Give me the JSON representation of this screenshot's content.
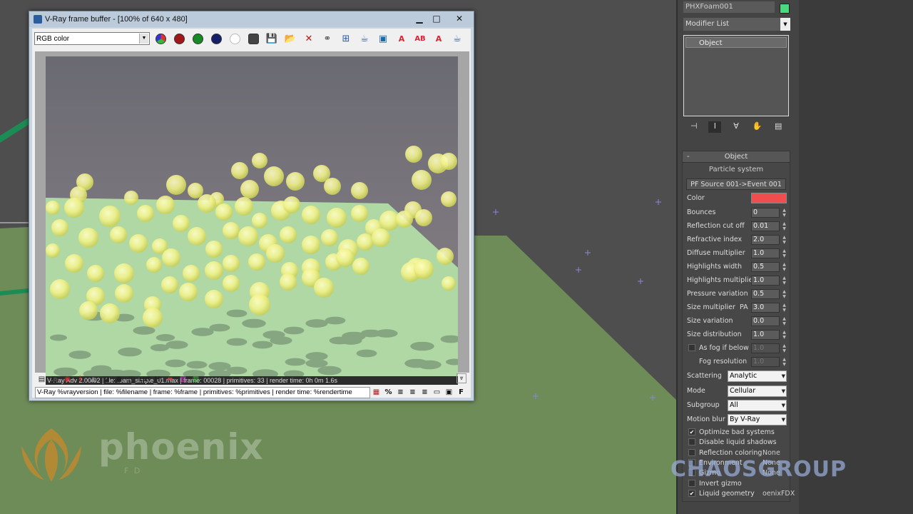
{
  "vfb": {
    "title": "V-Ray frame buffer - [100% of 640 x 480]",
    "minimize": "▁",
    "maximize": "□",
    "close": "✕",
    "channel": "RGB color",
    "status_line": "V-Ray Adv 2.00.02 | file: foam_simple_01.max | frame: 00028 | primitives: 33 | render time:  0h  0m  1.6s",
    "stamp_text": "V-Ray %vrayversion | file: %filename | frame: %frame | primitives: %primitives | render time: %rendertime",
    "stamp_percent": "%",
    "stamp_font": "F",
    "icon_h": "H",
    "icon_lut": "LUT",
    "icon_i": "i"
  },
  "command_panel": {
    "object_name": "PHXFoam001",
    "object_color": "#4bd87e",
    "modifier_list": "Modifier List",
    "stack_item": "Object"
  },
  "rollout": {
    "title": "Object",
    "collapse": "-",
    "particle_system": "Particle system",
    "pf_source": "PF Source 001->Event 001",
    "color_label": "Color",
    "color_value": "#f04e4e",
    "params": [
      {
        "label": "Bounces",
        "value": "0"
      },
      {
        "label": "Reflection cut off",
        "value": "0.01"
      },
      {
        "label": "Refractive index",
        "value": "2.0"
      },
      {
        "label": "Diffuse multiplier",
        "value": "1.0"
      },
      {
        "label": "Highlights width",
        "value": "0.5"
      },
      {
        "label": "Highlights multiplier",
        "value": "1.0"
      },
      {
        "label": "Pressure variation",
        "value": "0.5"
      },
      {
        "label": "Size multiplier",
        "value": "3.0",
        "prefix": "PA"
      },
      {
        "label": "Size variation",
        "value": "0.0"
      },
      {
        "label": "Size distribution",
        "value": "1.0"
      }
    ],
    "fog_if_below": {
      "label": "As fog if below",
      "value": "1.0",
      "checked": false
    },
    "fog_resolution": {
      "label": "Fog resolution",
      "value": "1.0"
    },
    "scattering": {
      "label": "Scattering",
      "value": "Analytic"
    },
    "mode": {
      "label": "Mode",
      "value": "Cellular"
    },
    "subgroup": {
      "label": "Subgroup",
      "value": "All"
    },
    "motion_blur": {
      "label": "Motion blur",
      "value": "By V-Ray"
    },
    "checkboxes": [
      {
        "label": "Optimize bad systems",
        "checked": true,
        "extra": ""
      },
      {
        "label": "Disable liquid shadows",
        "checked": false,
        "extra": ""
      },
      {
        "label": "Reflection coloring",
        "checked": false,
        "extra": "None"
      },
      {
        "label": "Environment",
        "checked": false,
        "extra": "None"
      },
      {
        "label": "Gizmo",
        "checked": false,
        "extra": "None"
      },
      {
        "label": "Invert gizmo",
        "checked": false,
        "extra": ""
      },
      {
        "label": "Liquid geometry",
        "checked": true,
        "extra": "oenixFDX"
      }
    ]
  },
  "watermarks": {
    "phoenix": "phoenix",
    "phoenix_sub": "F D",
    "chaos": "CHAOSGROUP"
  }
}
